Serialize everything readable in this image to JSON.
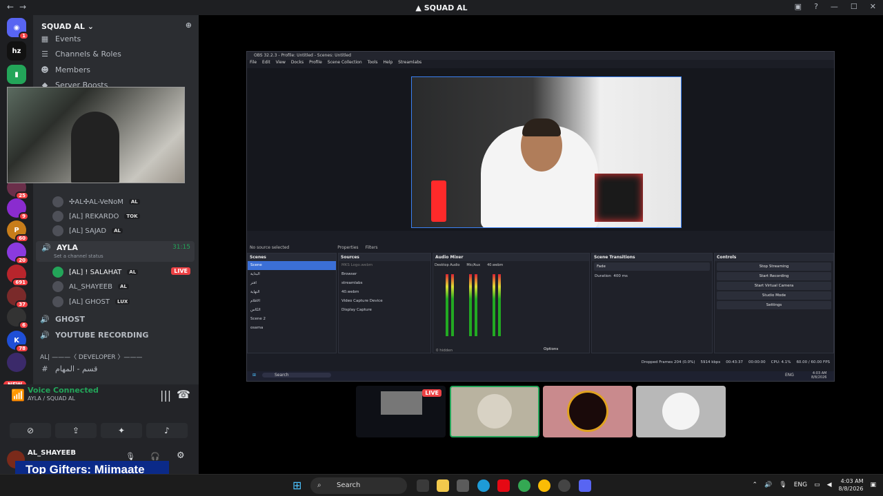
{
  "window": {
    "title": "SQUAD AL"
  },
  "server": {
    "name": "SQUAD AL",
    "badges": [
      "1",
      "25",
      "9",
      "60",
      "20",
      "691",
      "37",
      "6",
      "78"
    ],
    "new_label": "NEW",
    "logo_text": "hz"
  },
  "channels": {
    "events": "Events",
    "channels_roles": "Channels & Roles",
    "members": "Members",
    "server_boosts": "Server Boosts",
    "voice_members_top": [
      {
        "name": "✣AL✣AL-VeNoM",
        "tag": "AL"
      },
      {
        "name": "[AL] REKARDO",
        "tag": "TOK"
      },
      {
        "name": "[AL] SAJAD",
        "tag": "AL"
      }
    ],
    "ayla_channel": {
      "name": "AYLA",
      "time": "31:15",
      "status": "Set a channel status"
    },
    "ayla_members": [
      {
        "name": "[AL] ! SALAHAT",
        "tag": "AL",
        "live": "LIVE"
      },
      {
        "name": "AL_SHAYEEB",
        "tag": "AL"
      },
      {
        "name": "[AL] GHOST",
        "tag": "LUX"
      }
    ],
    "ghost_channel": "GHOST",
    "youtube_channel": "YOUTUBE RECORDING",
    "developer_category": "AL| ———〈 DEVELOPER 〉———",
    "tasks_channel": "قسم - المهام"
  },
  "voice_panel": {
    "title": "Voice Connected",
    "subtitle": "AYLA / SQUAD AL"
  },
  "user_panel": {
    "name": "AL_SHAYEEB"
  },
  "overlay": {
    "top_gifters": "Top Gifters: Miimaate"
  },
  "obs": {
    "title": "OBS 32.2.3 - Profile: Untitled - Scenes: Untitled",
    "menu": [
      "File",
      "Edit",
      "View",
      "Docks",
      "Profile",
      "Scene Collection",
      "Tools",
      "Help",
      "Streamlabs"
    ],
    "no_source": "No source selected",
    "properties": "Properties",
    "filters": "Filters",
    "scenes_title": "Scenes",
    "scenes": [
      "Scene",
      "البداية",
      "افتر",
      "النهاية",
      "الاقلام",
      "الكاس",
      "Scene 2",
      "osama"
    ],
    "sources_title": "Sources",
    "sources": [
      "MKS Logo.webm",
      "Browser",
      "streamlabs",
      "40.webm",
      "Video Capture Device",
      "Display Capture"
    ],
    "mixer_title": "Audio Mixer",
    "mixer_channels": [
      "Desktop Audio",
      "Mic/Aux",
      "40.webm"
    ],
    "mixer_hidden": "0 hidden",
    "transitions_title": "Scene Transitions",
    "transition": "Fade",
    "duration_label": "Duration",
    "duration_value": "400 ms",
    "controls_title": "Controls",
    "controls": [
      "Stop Streaming",
      "Start Recording",
      "Start Virtual Camera",
      "Studio Mode",
      "Settings"
    ],
    "options": "Options",
    "status": {
      "dropped": "Dropped Frames 204 (0.0%)",
      "kbps": "5914 kbps",
      "stream_time": "00:43:37",
      "rec_time": "00:00:00",
      "cpu": "CPU: 4.1%",
      "fps": "60.00 / 60.00 FPS"
    },
    "inner_task": {
      "search": "Search",
      "lang": "ENG",
      "time": "4:03 AM",
      "date": "8/8/2026"
    }
  },
  "stream_tiles": {
    "live": "LIVE"
  },
  "taskbar": {
    "search": "Search",
    "lang": "ENG",
    "time": "4:03 AM",
    "date": "8/8/2026"
  }
}
